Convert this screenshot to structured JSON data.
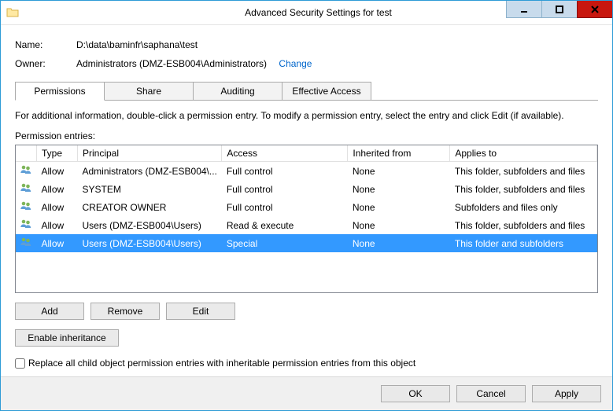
{
  "window": {
    "title": "Advanced Security Settings for test"
  },
  "header": {
    "name_label": "Name:",
    "name_value": "D:\\data\\baminfr\\saphana\\test",
    "owner_label": "Owner:",
    "owner_value": "Administrators (DMZ-ESB004\\Administrators)",
    "change_link": "Change"
  },
  "tabs": {
    "permissions": "Permissions",
    "share": "Share",
    "auditing": "Auditing",
    "effective_access": "Effective Access"
  },
  "info_text": "For additional information, double-click a permission entry. To modify a permission entry, select the entry and click Edit (if available).",
  "entries_label": "Permission entries:",
  "columns": {
    "type": "Type",
    "principal": "Principal",
    "access": "Access",
    "inherited": "Inherited from",
    "applies": "Applies to"
  },
  "rows": [
    {
      "type": "Allow",
      "principal": "Administrators (DMZ-ESB004\\...",
      "access": "Full control",
      "inherited": "None",
      "applies": "This folder, subfolders and files",
      "selected": false
    },
    {
      "type": "Allow",
      "principal": "SYSTEM",
      "access": "Full control",
      "inherited": "None",
      "applies": "This folder, subfolders and files",
      "selected": false
    },
    {
      "type": "Allow",
      "principal": "CREATOR OWNER",
      "access": "Full control",
      "inherited": "None",
      "applies": "Subfolders and files only",
      "selected": false
    },
    {
      "type": "Allow",
      "principal": "Users (DMZ-ESB004\\Users)",
      "access": "Read & execute",
      "inherited": "None",
      "applies": "This folder, subfolders and files",
      "selected": false
    },
    {
      "type": "Allow",
      "principal": "Users (DMZ-ESB004\\Users)",
      "access": "Special",
      "inherited": "None",
      "applies": "This folder and subfolders",
      "selected": true
    }
  ],
  "buttons": {
    "add": "Add",
    "remove": "Remove",
    "edit": "Edit",
    "enable_inheritance": "Enable inheritance",
    "ok": "OK",
    "cancel": "Cancel",
    "apply": "Apply"
  },
  "checkbox_label": "Replace all child object permission entries with inheritable permission entries from this object"
}
